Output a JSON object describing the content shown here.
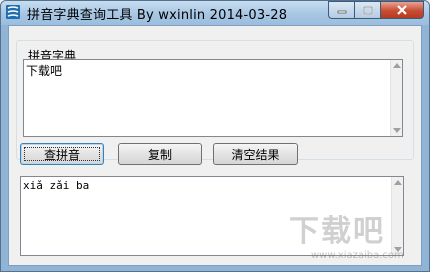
{
  "window": {
    "title": "拼音字典查询工具   By wxinlin  2014-03-28",
    "app_icon": "dictionary-app-icon",
    "controls": [
      "minimize-icon",
      "maximize-icon",
      "close-icon"
    ]
  },
  "group": {
    "label": "拼音字典"
  },
  "input": {
    "value": "下载吧"
  },
  "buttons": {
    "query": "查拼音",
    "copy": "复制",
    "clear": "清空结果"
  },
  "output": {
    "value": "xiǎ zǎi ba"
  },
  "watermark": {
    "main": "下载吧",
    "url": "www.xiazaiba.com"
  },
  "colors": {
    "titlebar": "#a7c6e3",
    "close_button": "#c84c32",
    "client_bg": "#f0f0f0",
    "focus_border": "#3c7fb1"
  }
}
